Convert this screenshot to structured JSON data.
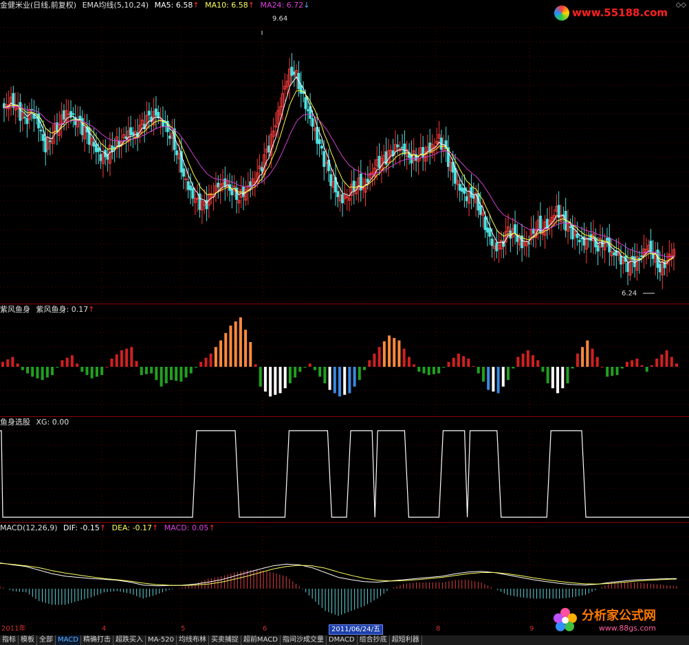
{
  "main": {
    "stock": "金健米业(日线,前复权)",
    "indicator": "EMA均线(5,10,24)",
    "ma5": "MA5: 6.58",
    "ma10": "MA10: 6.58",
    "ma24": "MA24: 6.72",
    "high_label": "9.64",
    "low_label": "6.24"
  },
  "fish": {
    "title": "紫风鱼身",
    "label": "紫风鱼身: 0.17"
  },
  "xg": {
    "title": "鱼身选股",
    "label": "XG: 0.00"
  },
  "macd": {
    "title": "MACD(12,26,9)",
    "dif": "DIF: -0.15",
    "dea": "DEA: -0.17",
    "macd": "MACD: 0.05"
  },
  "axis": {
    "year": "2011年",
    "m4": "4",
    "m5": "5",
    "m6": "6",
    "date": "2011/06/24/五",
    "m8": "8",
    "m9": "9"
  },
  "tabs": [
    "指标",
    "模板",
    "全部",
    "MACD",
    "精确打击",
    "超跌买入",
    "MA-520",
    "均线布林",
    "买卖捕捉",
    "超前MACD",
    "指间沙成交量",
    "DMACD",
    "组合抄底",
    "超短利器"
  ],
  "logos": {
    "top": "www.55188.com",
    "bottom_name": "分析家公式网",
    "bottom_url": "www.88gs.com"
  },
  "colors": {
    "up": "#ff3b3b",
    "down": "#4fe0e0",
    "ma5": "#ffffff",
    "ma10": "#ffff40",
    "ma24": "#d040d0"
  },
  "chart_data": {
    "type": "candlestick",
    "price_range": [
      5.9,
      9.9
    ],
    "closes": [
      8.55,
      8.65,
      8.5,
      8.35,
      8.5,
      8.3,
      8.0,
      8.2,
      8.35,
      8.5,
      8.4,
      8.3,
      8.15,
      8.0,
      7.85,
      7.9,
      8.05,
      8.1,
      8.2,
      8.15,
      8.3,
      8.4,
      8.45,
      8.35,
      8.2,
      7.95,
      7.6,
      7.35,
      7.2,
      7.15,
      7.3,
      7.45,
      7.5,
      7.4,
      7.3,
      7.4,
      7.5,
      7.65,
      7.9,
      8.2,
      8.6,
      9.0,
      9.1,
      8.8,
      8.5,
      8.2,
      7.9,
      7.6,
      7.35,
      7.25,
      7.35,
      7.5,
      7.45,
      7.6,
      7.75,
      7.8,
      7.9,
      8.0,
      7.95,
      7.85,
      7.9,
      7.95,
      8.0,
      8.1,
      7.9,
      7.6,
      7.4,
      7.3,
      7.35,
      7.1,
      6.8,
      6.55,
      6.6,
      6.8,
      6.75,
      6.6,
      6.7,
      6.9,
      6.85,
      6.95,
      7.1,
      6.95,
      6.8,
      6.7,
      6.65,
      6.75,
      6.6,
      6.7,
      6.5,
      6.45,
      6.3,
      6.35,
      6.4,
      6.6,
      6.5,
      6.3,
      6.4,
      6.55
    ],
    "fish": [
      0.3,
      0.6,
      -0.2,
      -0.6,
      -0.8,
      -0.5,
      0.4,
      0.7,
      -0.3,
      -0.7,
      -0.5,
      0.5,
      1.0,
      1.2,
      -0.5,
      -0.4,
      -1.2,
      -0.8,
      -0.9,
      -0.4,
      0.3,
      0.8,
      1.6,
      2.5,
      3.0,
      1.5,
      -1.2,
      -1.8,
      -1.6,
      -1.0,
      -0.3,
      0.2,
      -0.6,
      -1.4,
      -1.8,
      -1.6,
      -0.8,
      0.4,
      1.2,
      1.9,
      1.6,
      0.6,
      -0.3,
      -0.5,
      -0.4,
      0.3,
      0.8,
      0.5,
      -0.4,
      -1.4,
      -1.6,
      -0.8,
      0.6,
      1.0,
      0.4,
      -1.0,
      -1.6,
      -1.0,
      0.8,
      1.6,
      0.6,
      -0.6,
      -0.5,
      0.3,
      0.5,
      -0.3,
      0.5,
      1.0,
      0.2
    ],
    "xg_on": [
      [
        0,
        1
      ],
      [
        25,
        30
      ],
      [
        37,
        42
      ],
      [
        45,
        52
      ],
      [
        57,
        64
      ],
      [
        71,
        75
      ]
    ],
    "dif": [
      0.5,
      0.42,
      0.35,
      0.2,
      0.05,
      -0.05,
      -0.1,
      -0.15,
      -0.18,
      -0.22,
      -0.3,
      -0.42,
      -0.45,
      -0.44,
      -0.43,
      -0.38,
      -0.3,
      -0.2,
      -0.05,
      0.1,
      0.25,
      0.38,
      0.45,
      0.42,
      0.3,
      0.1,
      -0.1,
      -0.2,
      -0.28,
      -0.3,
      -0.25,
      -0.2,
      -0.15,
      -0.1,
      -0.05,
      0.05,
      0.12,
      0.15,
      0.1,
      0.0,
      -0.1,
      -0.2,
      -0.28,
      -0.35,
      -0.4,
      -0.42,
      -0.38,
      -0.3,
      -0.25,
      -0.2,
      -0.18,
      -0.16,
      -0.15
    ],
    "dea": [
      0.48,
      0.44,
      0.38,
      0.3,
      0.18,
      0.08,
      0.0,
      -0.08,
      -0.15,
      -0.2,
      -0.26,
      -0.34,
      -0.4,
      -0.43,
      -0.44,
      -0.42,
      -0.38,
      -0.3,
      -0.18,
      -0.05,
      0.1,
      0.25,
      0.35,
      0.4,
      0.38,
      0.28,
      0.12,
      -0.02,
      -0.14,
      -0.22,
      -0.25,
      -0.24,
      -0.2,
      -0.15,
      -0.1,
      -0.02,
      0.05,
      0.1,
      0.1,
      0.05,
      -0.03,
      -0.12,
      -0.2,
      -0.27,
      -0.33,
      -0.37,
      -0.38,
      -0.35,
      -0.3,
      -0.25,
      -0.22,
      -0.19,
      -0.17
    ]
  }
}
